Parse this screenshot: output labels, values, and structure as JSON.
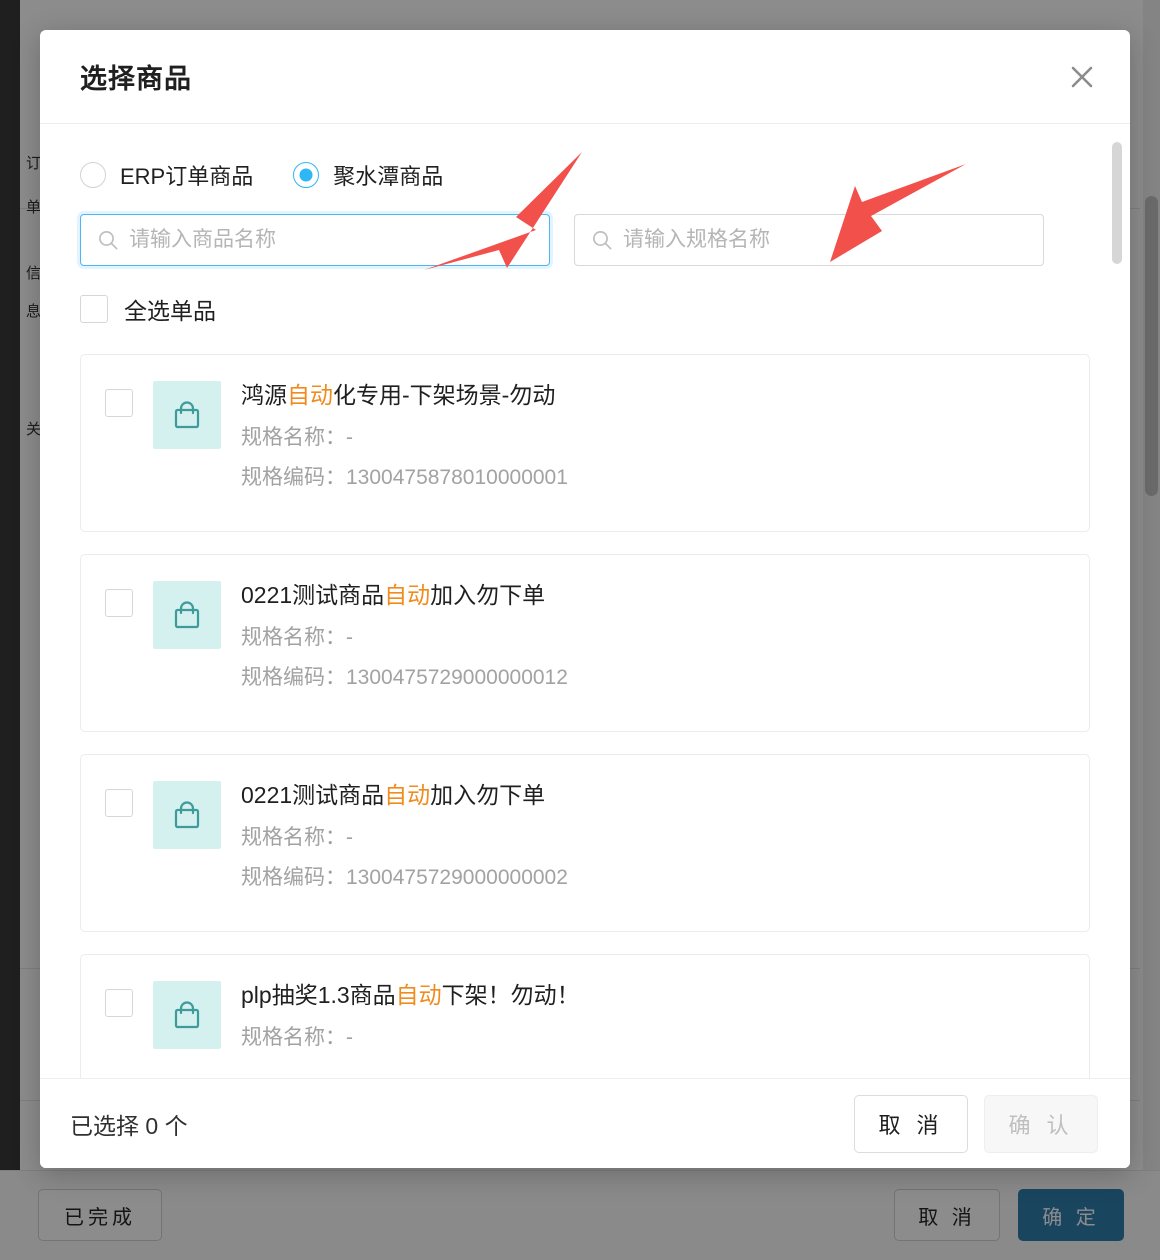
{
  "modal": {
    "title": "选择商品",
    "close_icon": "close-icon",
    "source_options": [
      {
        "label": "ERP订单商品",
        "selected": false
      },
      {
        "label": "聚水潭商品",
        "selected": true
      }
    ],
    "search": {
      "product_name": {
        "value": "",
        "placeholder": "请输入商品名称",
        "focused": true,
        "icon": "search-icon"
      },
      "spec_name": {
        "value": "",
        "placeholder": "请输入规格名称",
        "focused": false,
        "icon": "search-icon"
      }
    },
    "select_all": {
      "label": "全选单品",
      "checked": false
    },
    "labels": {
      "spec_name": "规格名称：",
      "spec_code": "规格编码："
    },
    "products": [
      {
        "name_before": "鸿源",
        "name_highlight": "自动",
        "name_after": "化专用-下架场景-勿动",
        "spec_name": "-",
        "spec_code": "1300475878010000001",
        "checked": false,
        "thumb_icon": "shopping-bag-icon"
      },
      {
        "name_before": "0221测试商品",
        "name_highlight": "自动",
        "name_after": "加入勿下单",
        "spec_name": "-",
        "spec_code": "1300475729000000012",
        "checked": false,
        "thumb_icon": "shopping-bag-icon"
      },
      {
        "name_before": "0221测试商品",
        "name_highlight": "自动",
        "name_after": "加入勿下单",
        "spec_name": "-",
        "spec_code": "1300475729000000002",
        "checked": false,
        "thumb_icon": "shopping-bag-icon"
      },
      {
        "name_before": "plp抽奖1.3商品",
        "name_highlight": "自动",
        "name_after": "下架！勿动！",
        "spec_name": "-",
        "spec_code": "",
        "checked": false,
        "thumb_icon": "shopping-bag-icon"
      }
    ],
    "footer": {
      "selected_text": "已选择 0 个",
      "cancel_label": "取 消",
      "confirm_label": "确 认",
      "confirm_disabled": true
    }
  },
  "background_page": {
    "done_label": "已完成",
    "cancel_label": "取 消",
    "ok_label": "确 定"
  },
  "colors": {
    "accent_blue": "#2db7f5",
    "focus_blue": "#49b8f5",
    "highlight_orange": "#f08c1d",
    "thumb_teal": "#3f9b9b",
    "thumb_bg": "#d4f1ef",
    "annotation_red": "#f2504b",
    "primary_button": "#2f7fad"
  },
  "annotations": [
    {
      "name": "arrow-to-product-name-input",
      "color": "#f2504b"
    },
    {
      "name": "arrow-to-spec-name-input",
      "color": "#f2504b"
    }
  ]
}
